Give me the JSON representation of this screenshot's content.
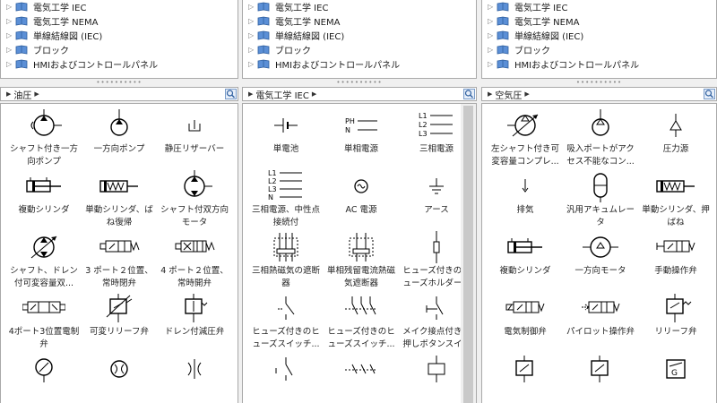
{
  "tree_items": [
    {
      "label": "電気工学 IEC"
    },
    {
      "label": "電気工学 NEMA"
    },
    {
      "label": "単線結線図 (IEC)"
    },
    {
      "label": "ブロック"
    },
    {
      "label": "HMIおよびコントロールパネル"
    }
  ],
  "panels": [
    {
      "breadcrumb": "油圧",
      "items": [
        "シャフト付き一方向ポンプ",
        "一方向ポンプ",
        "静圧リザーバー",
        "複動シリンダ",
        "単動シリンダ、ばね復帰",
        "シャフト付双方向モータ",
        "シャフト、ドレン付可変容量双...",
        "3 ポート２位置、常時閉弁",
        "4 ポート２位置、常時開弁",
        "4ポート3位置電制弁",
        "可変リリーフ弁",
        "ドレン付減圧弁",
        "",
        "",
        ""
      ]
    },
    {
      "breadcrumb": "電気工学 IEC",
      "items": [
        "単電池",
        "単相電源",
        "三相電源",
        "三相電源、中性点接続付",
        "AC 電源",
        "アース",
        "三相熱磁気の遮断器",
        "単相残留電流熱磁気遮断器",
        "ヒューズ付きのヒューズホルダー...",
        "ヒューズ付きのヒューズスイッチ...",
        "ヒューズ付きのヒューズスイッチ...",
        "メイク接点付きの押しボタンスイ...",
        "",
        "",
        ""
      ]
    },
    {
      "breadcrumb": "空気圧",
      "items": [
        "左シャフト付き可変容量コンプレ...",
        "吸入ポートがアクセス不能なコン...",
        "圧力源",
        "排気",
        "汎用アキュムレータ",
        "単動シリンダ、押ばね",
        "複動シリンダ",
        "一方向モータ",
        "手動操作弁",
        "電気制御弁",
        "パイロット操作弁",
        "リリーフ弁",
        "",
        "",
        ""
      ]
    }
  ],
  "icons": {
    "p0": [
      "pump-shaft-icon",
      "pump-icon",
      "reservoir-icon",
      "double-cylinder-icon",
      "spring-cylinder-icon",
      "bidirectional-motor-icon",
      "variable-motor-icon",
      "valve-3port-icon",
      "valve-4port-icon",
      "valve-3pos-icon",
      "relief-valve-variable-icon",
      "reducing-valve-icon",
      "gauge-icon",
      "flow-icon",
      "throttle-icon"
    ],
    "p1": [
      "battery-icon",
      "single-phase-icon",
      "three-phase-icon",
      "three-phase-neutral-icon",
      "ac-source-icon",
      "ground-icon",
      "breaker-3p-icon",
      "rcd-breaker-icon",
      "fuse-holder-icon",
      "fuse-switch-icon",
      "fuse-switch-3p-icon",
      "pushbutton-icon",
      "contact-icon",
      "contact-3p-icon",
      "coil-icon"
    ],
    "p2": [
      "variable-compressor-icon",
      "compressor-icon",
      "pressure-source-icon",
      "exhaust-icon",
      "accumulator-icon",
      "spring-cylinder-icon",
      "double-cylinder-icon",
      "motor-icon",
      "manual-valve-icon",
      "electric-valve-icon",
      "pilot-valve-icon",
      "relief-valve-icon",
      "valve-icon",
      "valve-icon",
      "display-icon"
    ]
  }
}
